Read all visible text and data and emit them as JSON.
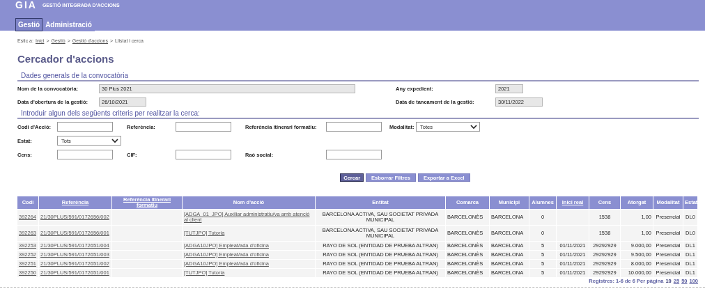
{
  "header": {
    "logo": "GIA",
    "subtitle": "GESTIÓ INTEGRADA D'ACCIONS"
  },
  "tabs": [
    {
      "label": "Gestió",
      "selected": true
    },
    {
      "label": "Administració",
      "selected": false
    }
  ],
  "breadcrumb": {
    "prefix": "Estic a:",
    "items": [
      {
        "label": "Inici",
        "link": true
      },
      {
        "label": "Gestió",
        "link": true
      },
      {
        "label": "Gestió d'accions",
        "link": true
      },
      {
        "label": "Llistat i cerca",
        "link": false
      }
    ],
    "separator": ">"
  },
  "title": "Cercador d'accions",
  "general": {
    "heading": "Dades generals de la convocatòria",
    "fields": [
      {
        "label": "Nom de la convocatòria:",
        "value": "30 Plus 2021"
      },
      {
        "label": "Any expedient:",
        "value": "2021"
      },
      {
        "label": "Data d'obertura de la gestió:",
        "value": "26/10/2021"
      },
      {
        "label": "Data de tancament de la gestió:",
        "value": "30/11/2022"
      }
    ]
  },
  "criteria": {
    "heading": "Introduir algun dels següents criteris per realitzar la cerca:",
    "rows": [
      [
        {
          "label": "Codi d'Acció:",
          "kind": "input"
        },
        {
          "label": "Referència:",
          "kind": "input"
        },
        {
          "label": "Referència itinerari formatiu:",
          "kind": "input"
        },
        {
          "label": "Modalitat:",
          "kind": "select",
          "value": "Totes"
        }
      ],
      [
        {
          "label": "Estat:",
          "kind": "select",
          "value": "Tots"
        }
      ],
      [
        {
          "label": "Cens:",
          "kind": "input"
        },
        {
          "label": "CIF:",
          "kind": "input"
        },
        {
          "label": "Raó social:",
          "kind": "input"
        }
      ]
    ]
  },
  "buttons": [
    {
      "label": "Cercar",
      "kind": "primary"
    },
    {
      "label": "Esborrar Filtres",
      "kind": "secondary"
    },
    {
      "label": "Exportar a Excel",
      "kind": "secondary"
    }
  ],
  "table": {
    "columns": [
      {
        "label": "Codi",
        "sortable": false,
        "link_cells": true
      },
      {
        "label": "Referència",
        "sortable": true,
        "link_cells": true
      },
      {
        "label": "Referència itinerari formatiu",
        "sortable": true
      },
      {
        "label": "Nom d'acció",
        "sortable": false,
        "link_cells": true
      },
      {
        "label": "Entitat",
        "sortable": false,
        "link_cells": false
      },
      {
        "label": "Comarca",
        "sortable": false,
        "link_cells": false
      },
      {
        "label": "Municipi",
        "sortable": false,
        "link_cells": false
      },
      {
        "label": "Alumnes",
        "sortable": false,
        "link_cells": false
      },
      {
        "label": "Inici real",
        "sortable": true,
        "link_cells": false
      },
      {
        "label": "Cens",
        "sortable": false,
        "link_cells": false
      },
      {
        "label": "Atorgat",
        "sortable": false,
        "link_cells": false
      },
      {
        "label": "Modalitat",
        "sortable": false,
        "link_cells": false
      },
      {
        "label": "Estat",
        "sortable": false,
        "link_cells": false
      }
    ],
    "rows": [
      [
        "392264",
        "21/30PLUS/591/0172656/002",
        "",
        "[ADGA_01_JPO] Auxiliar administratiu/va amb atenció al client",
        "BARCELONA ACTIVA, SAU SOCIETAT PRIVADA MUNICIPAL",
        "BARCELONÈS",
        "BARCELONA",
        "0",
        "",
        "1538",
        "1,00",
        "Presencial",
        "DL0"
      ],
      [
        "392263",
        "21/30PLUS/591/0172656/001",
        "",
        "[TUTJPO] Tutoria",
        "BARCELONA ACTIVA, SAU SOCIETAT PRIVADA MUNICIPAL",
        "BARCELONÈS",
        "BARCELONA",
        "0",
        "",
        "1538",
        "1,00",
        "Presencial",
        "DL0"
      ],
      [
        "392253",
        "21/30PLUS/591/0172651/004",
        "",
        "[ADGA10JPO] Empleat/ada d'oficina",
        "RAYO DE SOL (ENTIDAD DE PRUEBA ALTRAN)",
        "BARCELONÈS",
        "BARCELONA",
        "5",
        "01/11/2021",
        "29292929",
        "9.000,00",
        "Presencial",
        "DL1"
      ],
      [
        "392252",
        "21/30PLUS/591/0172651/003",
        "",
        "[ADGA10JPO] Empleat/ada d'oficina",
        "RAYO DE SOL (ENTIDAD DE PRUEBA ALTRAN)",
        "BARCELONÈS",
        "BARCELONA",
        "5",
        "01/11/2021",
        "29292929",
        "9.500,00",
        "Presencial",
        "DL1"
      ],
      [
        "392251",
        "21/30PLUS/591/0172651/002",
        "",
        "[ADGA10JPO] Empleat/ada d'oficina",
        "RAYO DE SOL (ENTIDAD DE PRUEBA ALTRAN)",
        "BARCELONÈS",
        "BARCELONA",
        "5",
        "01/11/2021",
        "29292929",
        "8.000,00",
        "Presencial",
        "DL1"
      ],
      [
        "392250",
        "21/30PLUS/591/0172651/001",
        "",
        "[TUTJPO] Tutoria",
        "RAYO DE SOL (ENTIDAD DE PRUEBA ALTRAN)",
        "BARCELONÈS",
        "BARCELONA",
        "5",
        "01/11/2021",
        "29292929",
        "10.000,00",
        "Presencial",
        "DL1"
      ]
    ]
  },
  "pagination": {
    "summary": "Registres: 1-6 de 6 Per pàgina",
    "sizes": [
      {
        "label": "10",
        "selected": true
      },
      {
        "label": "25",
        "selected": false
      },
      {
        "label": "50",
        "selected": false
      },
      {
        "label": "100",
        "selected": false
      }
    ]
  }
}
